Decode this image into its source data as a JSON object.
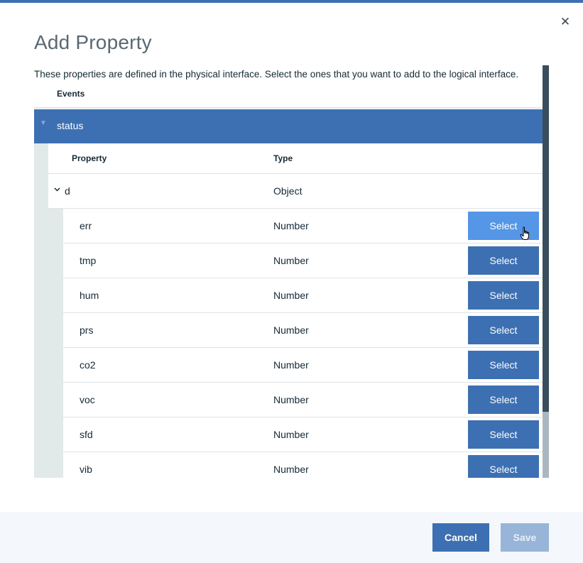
{
  "dialog": {
    "title": "Add Property",
    "close_icon": "close-icon",
    "description": "These properties are defined in the physical interface. Select the ones that you want to add to the logical interface."
  },
  "events": {
    "label": "Events",
    "group": {
      "name": "status",
      "icon": "chevron-down-icon"
    }
  },
  "table": {
    "columns": {
      "property": "Property",
      "type": "Type"
    },
    "parent": {
      "name": "d",
      "type": "Object",
      "icon": "chevron-down-icon"
    },
    "rows": [
      {
        "name": "err",
        "type": "Number",
        "action": "Select"
      },
      {
        "name": "tmp",
        "type": "Number",
        "action": "Select"
      },
      {
        "name": "hum",
        "type": "Number",
        "action": "Select"
      },
      {
        "name": "prs",
        "type": "Number",
        "action": "Select"
      },
      {
        "name": "co2",
        "type": "Number",
        "action": "Select"
      },
      {
        "name": "voc",
        "type": "Number",
        "action": "Select"
      },
      {
        "name": "sfd",
        "type": "Number",
        "action": "Select"
      },
      {
        "name": "vib",
        "type": "Number",
        "action": "Select"
      }
    ]
  },
  "footer": {
    "cancel_label": "Cancel",
    "save_label": "Save"
  },
  "colors": {
    "accent": "#3d70b2",
    "hover": "#5596e6",
    "disabled": "#98b4d8"
  }
}
